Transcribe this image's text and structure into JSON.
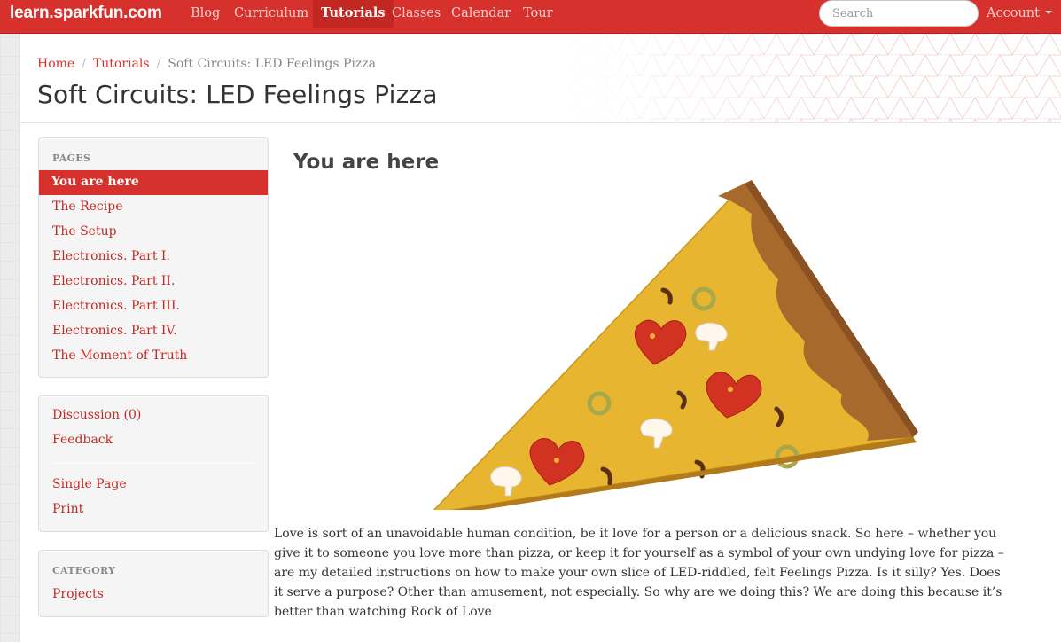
{
  "navbar": {
    "brand": "learn.sparkfun.com",
    "items": [
      {
        "label": "Blog"
      },
      {
        "label": "Curriculum"
      },
      {
        "label": "Tutorials"
      },
      {
        "label": "Classes"
      },
      {
        "label": "Calendar"
      },
      {
        "label": "Tour"
      }
    ],
    "search_placeholder": "Search",
    "account_label": "Account"
  },
  "breadcrumb": {
    "home": "Home",
    "tutorials": "Tutorials",
    "current": "Soft Circuits: LED Feelings Pizza",
    "separator": "/"
  },
  "page_title": "Soft Circuits: LED Feelings Pizza",
  "sidebar": {
    "pages_heading": "PAGES",
    "pages": [
      {
        "label": "You are here"
      },
      {
        "label": "The Recipe"
      },
      {
        "label": "The Setup"
      },
      {
        "label": "Electronics. Part I."
      },
      {
        "label": "Electronics. Part II."
      },
      {
        "label": "Electronics. Part III."
      },
      {
        "label": "Electronics. Part IV."
      },
      {
        "label": "The Moment of Truth"
      }
    ],
    "discussion": "Discussion (0)",
    "feedback": "Feedback",
    "single_page": "Single Page",
    "print": "Print",
    "category_heading": "CATEGORY",
    "category": "Projects"
  },
  "main": {
    "section_title": "You are here",
    "intro": "Love is sort of an unavoidable human condition, be it love for a person or a delicious snack. So here – whether you give it to someone you love more than pizza, or keep it for yourself as a symbol of your own undying love for pizza – are my detailed instructions on how to make your own slice of LED-riddled, felt Feelings Pizza. Is it silly? Yes. Does it serve a purpose? Other than amusement, not especially. So why are we doing this? We are doing this because it’s better than watching Rock of Love"
  },
  "colors": {
    "brand_red": "#d6312c",
    "link_red": "#c02a25",
    "cheese": "#e7b52f",
    "crust": "#a8692c"
  }
}
